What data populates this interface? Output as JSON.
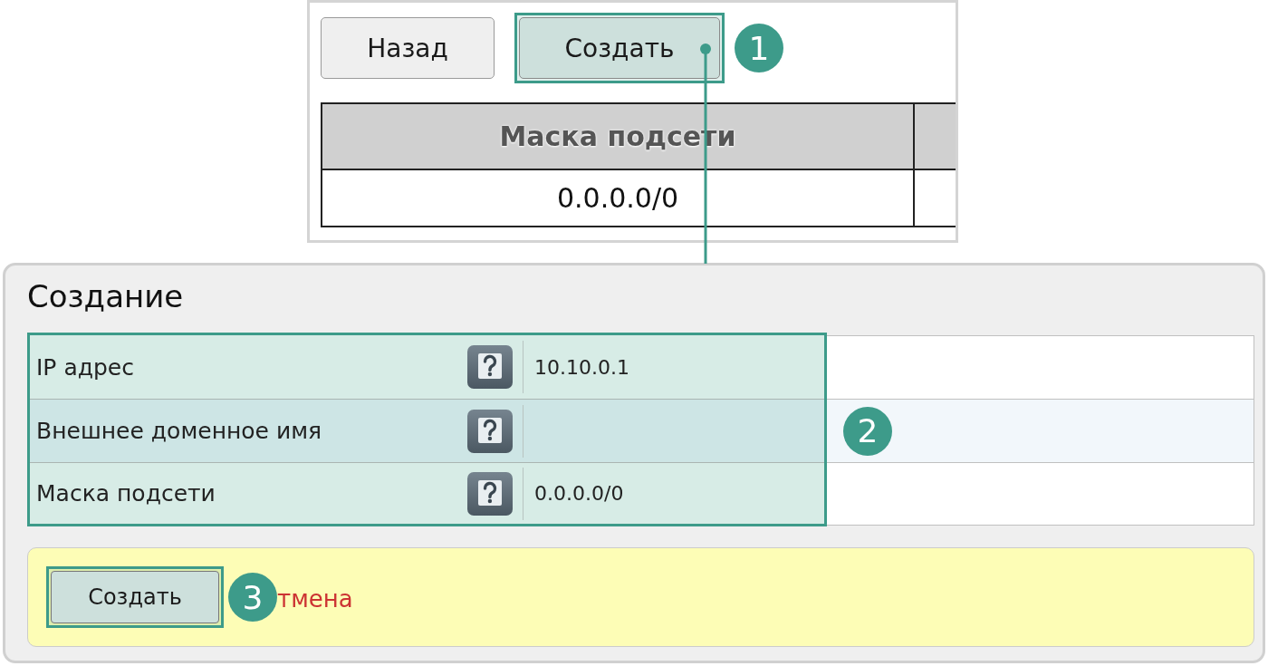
{
  "top_panel": {
    "buttons": [
      {
        "label": "Назад",
        "highlighted": false
      },
      {
        "label": "Создать",
        "highlighted": true,
        "callout": "1"
      }
    ],
    "table": {
      "columns": [
        "Маска подсети"
      ],
      "rows": [
        [
          "0.0.0.0/0"
        ]
      ]
    }
  },
  "create_form": {
    "title": "Создание",
    "highlighted": true,
    "callout": "2",
    "fields": [
      {
        "label": "IP адрес",
        "value": "10.10.0.1"
      },
      {
        "label": "Внешнее доменное имя"
      },
      {
        "label": "Маска подсети",
        "value": "0.0.0.0/0"
      }
    ],
    "actions": {
      "submit": {
        "label": "Создать",
        "highlighted": true,
        "callout": "3"
      },
      "cancel": "тмена"
    }
  }
}
